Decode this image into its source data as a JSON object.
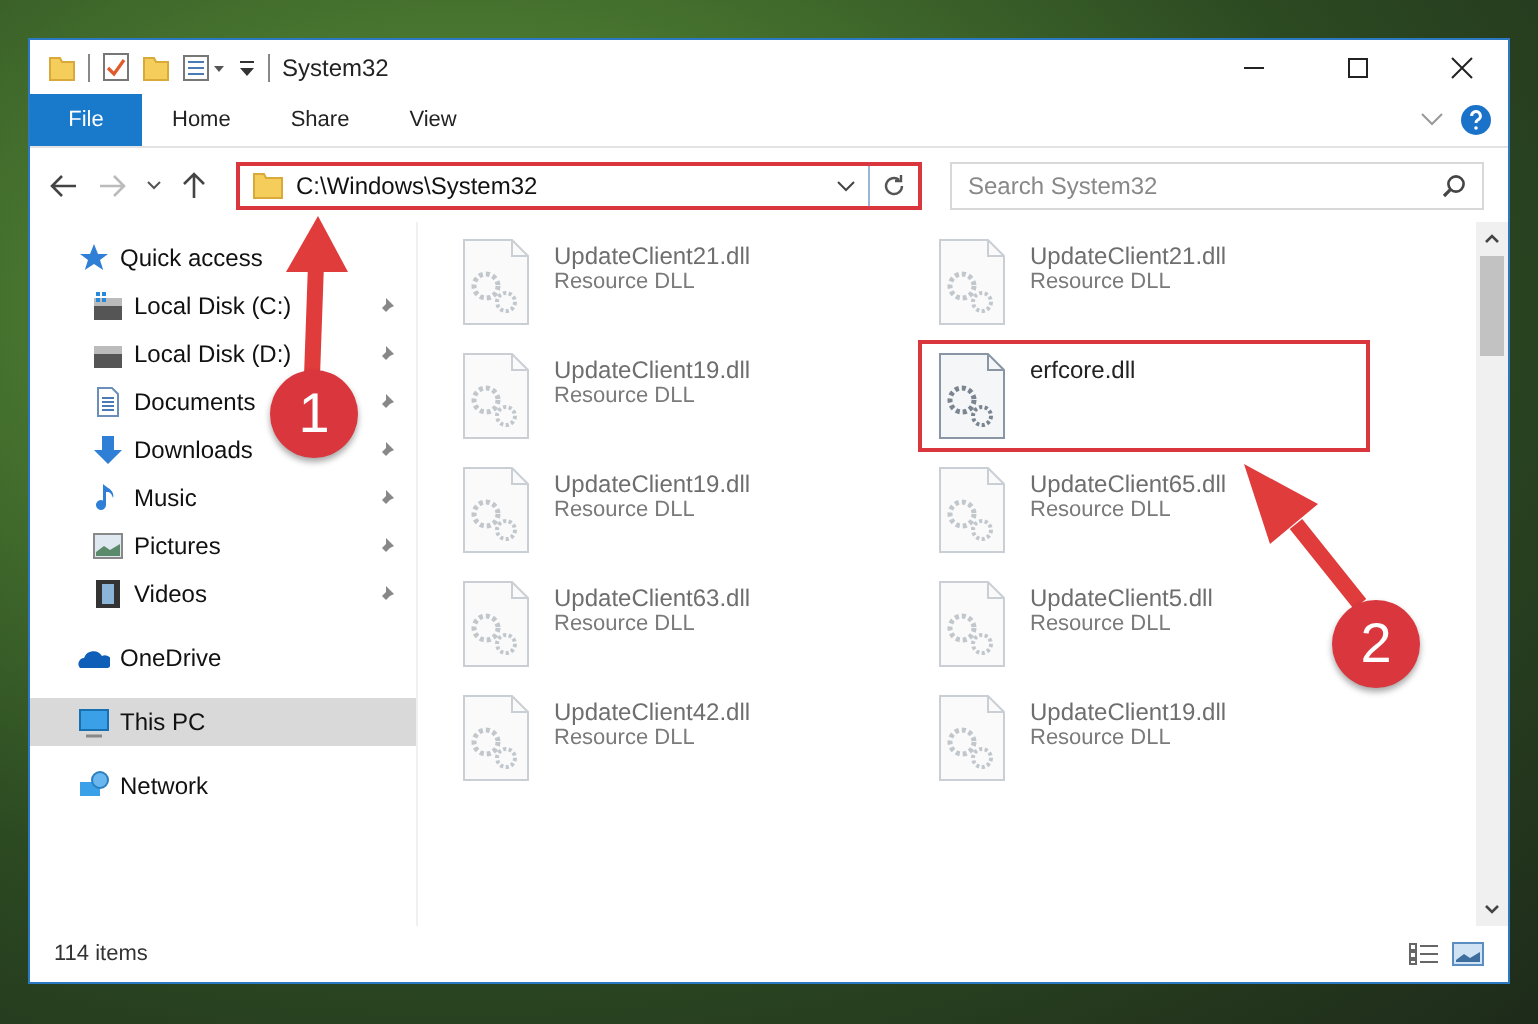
{
  "window": {
    "title": "System32"
  },
  "ribbon_tabs": [
    {
      "label": "File",
      "selected": true
    },
    {
      "label": "Home",
      "selected": false
    },
    {
      "label": "Share",
      "selected": false
    },
    {
      "label": "View",
      "selected": false
    }
  ],
  "address_bar": {
    "path": "C:\\Windows\\System32",
    "highlighted": true
  },
  "search": {
    "placeholder": "Search System32"
  },
  "sidebar": {
    "items": [
      {
        "label": "Quick access",
        "kind": "star",
        "pinned": false,
        "selected": false,
        "indent": false
      },
      {
        "label": "Local Disk (C:)",
        "kind": "drive-c",
        "pinned": true,
        "selected": false,
        "indent": true
      },
      {
        "label": "Local Disk (D:)",
        "kind": "drive",
        "pinned": true,
        "selected": false,
        "indent": true
      },
      {
        "label": "Documents",
        "kind": "document",
        "pinned": true,
        "selected": false,
        "indent": true
      },
      {
        "label": "Downloads",
        "kind": "download",
        "pinned": true,
        "selected": false,
        "indent": true
      },
      {
        "label": "Music",
        "kind": "music",
        "pinned": true,
        "selected": false,
        "indent": true
      },
      {
        "label": "Pictures",
        "kind": "picture",
        "pinned": true,
        "selected": false,
        "indent": true
      },
      {
        "label": "Videos",
        "kind": "video",
        "pinned": true,
        "selected": false,
        "indent": true
      },
      {
        "label": "OneDrive",
        "kind": "cloud",
        "pinned": false,
        "selected": false,
        "indent": false
      },
      {
        "label": "This PC",
        "kind": "pc",
        "pinned": false,
        "selected": true,
        "indent": false
      },
      {
        "label": "Network",
        "kind": "network",
        "pinned": false,
        "selected": false,
        "indent": false
      }
    ]
  },
  "files": [
    {
      "name": "UpdateClient21.dll",
      "type": "Resource DLL",
      "faded": true,
      "highlighted": false
    },
    {
      "name": "UpdateClient21.dll",
      "type": "Resource DLL",
      "faded": true,
      "highlighted": false
    },
    {
      "name": "UpdateClient19.dll",
      "type": "Resource DLL",
      "faded": true,
      "highlighted": false
    },
    {
      "name": "erfcore.dll",
      "faded": false,
      "highlighted": true
    },
    {
      "name": "UpdateClient19.dll",
      "type": "Resource DLL",
      "faded": true,
      "highlighted": false
    },
    {
      "name": "UpdateClient65.dll",
      "type": "Resource DLL",
      "faded": true,
      "highlighted": false
    },
    {
      "name": "UpdateClient63.dll",
      "type": "Resource DLL",
      "faded": true,
      "highlighted": false
    },
    {
      "name": "UpdateClient5.dll",
      "type": "Resource DLL",
      "faded": true,
      "highlighted": false
    },
    {
      "name": "UpdateClient42.dll",
      "type": "Resource DLL",
      "faded": true,
      "highlighted": false
    },
    {
      "name": "UpdateClient19.dll",
      "type": "Resource DLL",
      "faded": true,
      "highlighted": false
    }
  ],
  "status_bar": {
    "item_count": "114 items"
  },
  "annotations": [
    {
      "label": "1"
    },
    {
      "label": "2"
    }
  ]
}
